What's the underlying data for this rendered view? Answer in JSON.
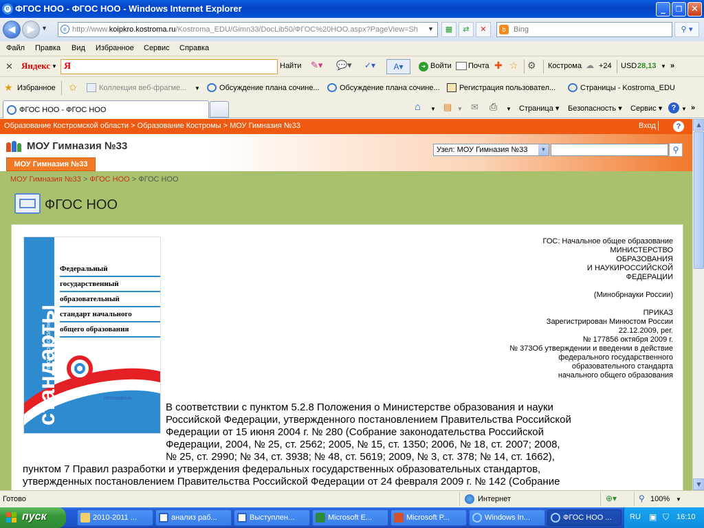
{
  "window": {
    "title": "ФГОС НОО - ФГОС НОО - Windows Internet Explorer",
    "minimize": "_",
    "maximize": "❐",
    "close": "✕"
  },
  "address": {
    "url_prefix": "http://www.",
    "url_domain": "koipkro.kostroma.ru",
    "url_rest": "/Kostroma_EDU/Gimn33/DocLib50/ФГОС%20НОО.aspx?PageView=Sh",
    "search_engine": "Bing"
  },
  "menu": [
    "Файл",
    "Правка",
    "Вид",
    "Избранное",
    "Сервис",
    "Справка"
  ],
  "yandex": {
    "brand": "Яндекс",
    "input_value": "Я",
    "find": "Найти",
    "login": "Войти",
    "mail": "Почта",
    "city": "Кострома",
    "weather": "+24",
    "currency_label": "USD",
    "currency_value": "28,13"
  },
  "favorites": {
    "label": "Избранное",
    "items": [
      "Коллекция веб-фрагме...",
      "Обсуждение плана сочине...",
      "Обсуждение плана сочине...",
      "Регистрация пользовател...",
      "Страницы - Kostroma_EDU"
    ]
  },
  "tabs": {
    "active": "ФГОС НОО - ФГОС НОО",
    "commands": [
      "Страница",
      "Безопасность",
      "Сервис"
    ]
  },
  "site": {
    "top_breadcrumb": "Образование Костромской области > Образование Костромы > МОУ Гимназия №33",
    "login": "Вход",
    "help": "?",
    "site_title": "МОУ Гимназия №33",
    "node_select": "Узел: МОУ Гимназия №33",
    "nav_tab": "МОУ Гимназия №33",
    "breadcrumb_link1": "МОУ Гимназия №33",
    "breadcrumb_link2": "ФГОС НОО",
    "breadcrumb_current": "ФГОС НОО",
    "page_title": "ФГОС НОО"
  },
  "book": {
    "vertical_small": "второго поколения",
    "vertical_big": "стандарты",
    "lines": [
      "Федеральный",
      "государственный",
      "образовательный",
      "стандарт начального",
      "общего образования"
    ],
    "publisher": "ПРОСВЕЩЕНИЕ"
  },
  "doc": {
    "right_lines": [
      "ГОС: Начальное общее образование",
      "МИНИСТЕРСТВО",
      "ОБРАЗОВАНИЯ",
      "И НАУКИРОССИЙСКОЙ",
      "ФЕДЕРАЦИИ",
      "",
      "(Минобрнауки России)",
      "",
      "ПРИКАЗ",
      "Зарегистрирован Минюстом России",
      "22.12.2009, рег.",
      "№ 177856 октября 2009 г.",
      "№ 373Об утверждении и введении в действие",
      "федерального государственного",
      "образовательного стандарта",
      "начального общего образования"
    ],
    "body_lines": [
      "В соответствии с пунктом 5.2.8 Положения о Министерстве образования и науки",
      "Российской Федерации, утвержденного постановлением Правительства Российской",
      "Федерации от 15 июня 2004 г. № 280 (Собрание законодательства Российской",
      "Федерации, 2004, № 25, ст. 2562; 2005, № 15, ст. 1350; 2006, № 18, ст. 2007; 2008,",
      "№ 25, ст. 2990; № 34, ст. 3938; № 48, ст. 5619; 2009, № 3, ст. 378; № 14, ст. 1662),",
      "пунктом 7 Правил разработки и утверждения федеральных государственных образовательных стандартов,",
      "утвержденных постановлением Правительства Российской Федерации от 24 февраля 2009 г. № 142 (Собрание"
    ]
  },
  "status": {
    "text": "Готово",
    "zone": "Интернет",
    "zoom": "100%"
  },
  "taskbar": {
    "start": "пуск",
    "items": [
      "2010-2011 ...",
      "анализ раб...",
      "Выступлен...",
      "Microsoft E...",
      "Microsoft P...",
      "Windows In...",
      "ФГОС НОО ..."
    ],
    "lang": "RU",
    "clock": "16:10"
  }
}
